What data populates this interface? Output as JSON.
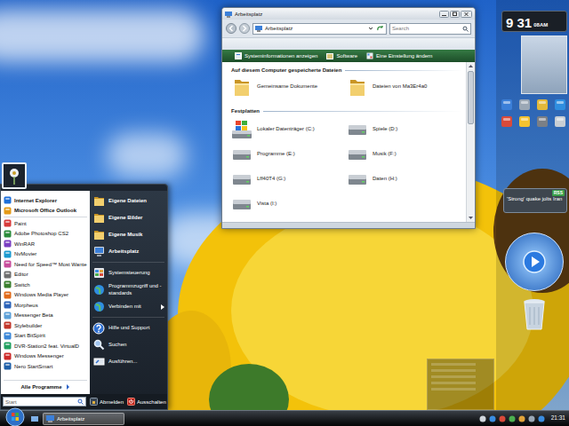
{
  "explorer": {
    "title": "Arbeitsplatz",
    "address": "Arbeitsplatz",
    "search_placeholder": "Search",
    "toolbar": [
      "Systeminformationen anzeigen",
      "Software",
      "Eine Einstellung ändern"
    ],
    "groups": [
      {
        "heading": "Auf diesem Computer gespeicherte Dateien",
        "items": [
          {
            "label": "Gemeinsame Dokumente",
            "kind": "folder"
          },
          {
            "label": "Dateien von Ma3Er4a0",
            "kind": "folder"
          }
        ]
      },
      {
        "heading": "Festplatten",
        "items": [
          {
            "label": "Lokaler Datenträger (C:)",
            "kind": "system"
          },
          {
            "label": "Spiele (D:)",
            "kind": "drive"
          },
          {
            "label": "Programme (E:)",
            "kind": "drive"
          },
          {
            "label": "Musik (F:)",
            "kind": "drive"
          },
          {
            "label": "Lff40T4 (G:)",
            "kind": "drive"
          },
          {
            "label": "Daten (H:)",
            "kind": "drive"
          },
          {
            "label": "Vista (I:)",
            "kind": "drive"
          }
        ]
      }
    ]
  },
  "start_menu": {
    "pinned": [
      "Internet Explorer",
      "Microsoft Office Outlook"
    ],
    "recent": [
      "Paint",
      "Adobe Photoshop CS2",
      "WinRAR",
      "NvMovier",
      "Need for Speed™ Most Wante",
      "Editor",
      "Switch",
      "Windows Media Player",
      "Morpheus",
      "Messenger Beta",
      "Stylebuilder",
      "Start BitSpirit",
      "DVR-Station2 feat. VirtualD",
      "Windows Messenger",
      "Nero StartSmart"
    ],
    "all_programs": "Alle Programme",
    "search_placeholder": "Start",
    "places": [
      {
        "items": [
          {
            "label": "Eigene Dateien",
            "kind": "folder",
            "emphasized": true,
            "submenu": false
          },
          {
            "label": "Eigene Bilder",
            "kind": "folder",
            "emphasized": true,
            "submenu": false
          },
          {
            "label": "Eigene Musik",
            "kind": "folder",
            "emphasized": true,
            "submenu": false
          },
          {
            "label": "Arbeitsplatz",
            "kind": "computer",
            "emphasized": true,
            "submenu": false
          }
        ]
      },
      {
        "items": [
          {
            "label": "Systemsteuerung",
            "kind": "control",
            "emphasized": false,
            "submenu": false
          },
          {
            "label": "Programmzugriff und -standards",
            "kind": "globe",
            "emphasized": false,
            "submenu": false
          },
          {
            "label": "Verbinden mit",
            "kind": "globe",
            "emphasized": false,
            "submenu": true
          }
        ]
      },
      {
        "items": [
          {
            "label": "Hilfe und Support",
            "kind": "help",
            "emphasized": false,
            "submenu": false
          },
          {
            "label": "Suchen",
            "kind": "search",
            "emphasized": false,
            "submenu": false
          },
          {
            "label": "Ausführen...",
            "kind": "run",
            "emphasized": false,
            "submenu": false
          }
        ]
      }
    ],
    "logoff": "Abmelden",
    "shutdown": "Ausschalten"
  },
  "taskbar": {
    "buttons": [
      {
        "label": "Arbeitsplatz",
        "selected": true
      }
    ],
    "clock": "21:31"
  },
  "sidebar": {
    "clock": {
      "time": "9 31",
      "suffix": "08AM"
    },
    "rss": {
      "badge": "RSS",
      "headline": "'Strong' quake jolts Iran"
    }
  }
}
